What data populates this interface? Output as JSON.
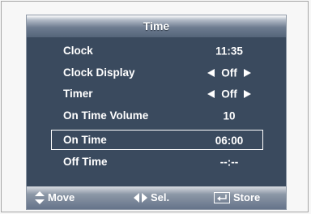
{
  "menu": {
    "title": "Time",
    "items": [
      {
        "label": "Clock",
        "value": "11:35",
        "arrows": false
      },
      {
        "label": "Clock Display",
        "value": "Off",
        "arrows": true
      },
      {
        "label": "Timer",
        "value": "Off",
        "arrows": true
      },
      {
        "label": "On Time Volume",
        "value": "10",
        "arrows": false
      },
      {
        "label": "On Time",
        "value": "06:00",
        "arrows": false,
        "selected": true
      },
      {
        "label": "Off Time",
        "value": "--:--",
        "arrows": false
      }
    ]
  },
  "footer": {
    "move_label": "Move",
    "select_label": "Sel.",
    "store_label": "Store",
    "icons": {
      "move": "up-down-arrow-icon",
      "select": "left-right-arrow-icon",
      "store": "enter-icon"
    }
  },
  "colors": {
    "panel_background": "#3a4a5e",
    "text": "#ffffff",
    "page_background": "#f7f7f7"
  }
}
